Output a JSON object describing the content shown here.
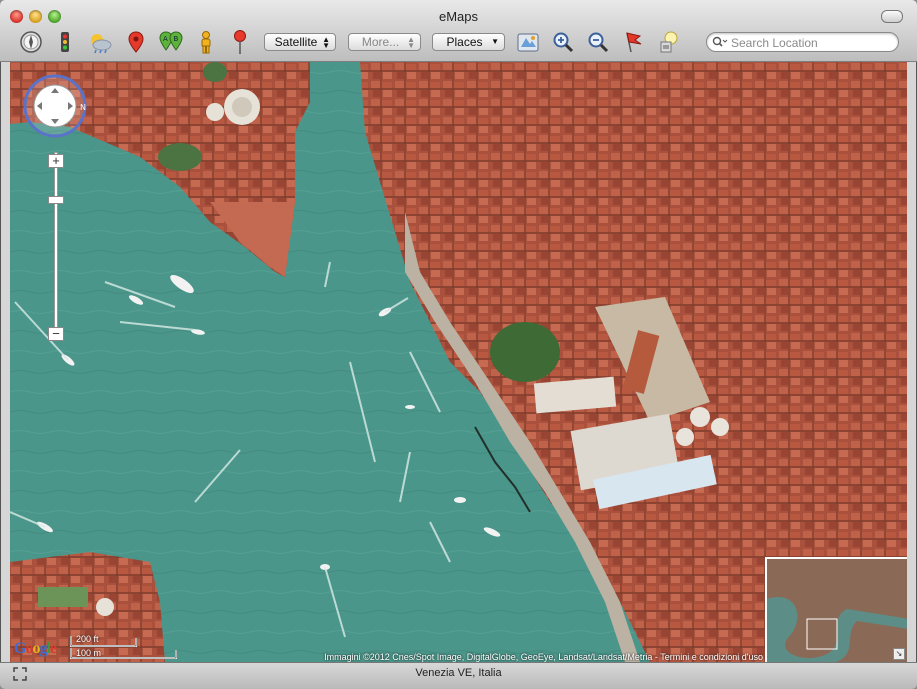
{
  "window": {
    "title": "eMaps"
  },
  "toolbar": {
    "icons": [
      "compass-icon",
      "traffic-light-icon",
      "weather-icon",
      "pin-icon",
      "directions-ab-icon",
      "street-view-person-icon",
      "marker-icon",
      "view-3d-icon",
      "zoom-in-icon",
      "zoom-out-icon",
      "flag-icon",
      "lamp-icon"
    ],
    "map_type": "Satellite",
    "more_label": "More...",
    "places_label": "Places",
    "search_placeholder": "Search Location"
  },
  "map": {
    "attribution": "Immagini ©2012 Cnes/Spot Image, DigitalGlobe, GeoEye, Landsat/Landsat/Metria - Termini e condizioni d'uso",
    "scale_ft": "200 ft",
    "scale_m": "100 m",
    "logo": "Google",
    "zoom_in": "+",
    "zoom_out": "−"
  },
  "status": {
    "location": "Venezia VE, Italia"
  },
  "colors": {
    "water": "#4a9588",
    "roofs": "#b2543e",
    "toolbar_bg": "#cfcfcf"
  }
}
